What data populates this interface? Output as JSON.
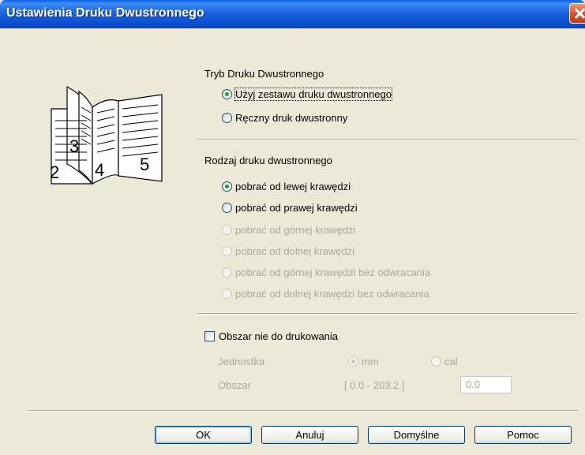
{
  "window": {
    "title": "Ustawienia Druku Dwustronnego"
  },
  "duplex_mode": {
    "label": "Tryb Druku Dwustronnego",
    "options": [
      {
        "label": "Użyj zestawu druku dwustronnego",
        "checked": true
      },
      {
        "label": "Ręczny druk dwustronny",
        "checked": false
      }
    ]
  },
  "illustration": {
    "page_numbers": [
      "2",
      "3",
      "4",
      "5"
    ]
  },
  "duplex_type": {
    "label": "Rodzaj druku dwustronnego",
    "options": [
      {
        "label": "pobrać od lewej krawędzi",
        "checked": true,
        "enabled": true
      },
      {
        "label": "pobrać od prawej krawędzi",
        "checked": false,
        "enabled": true
      },
      {
        "label": "pobrać od górnej krawędzi",
        "checked": false,
        "enabled": false
      },
      {
        "label": "pobrać od dolnej krawędzi",
        "checked": false,
        "enabled": false
      },
      {
        "label": "pobrać od górnej krawędzi bez odwracania",
        "checked": false,
        "enabled": false
      },
      {
        "label": "pobrać od dolnej krawędzi bez odwracania",
        "checked": false,
        "enabled": false
      }
    ]
  },
  "binding_offset": {
    "checkbox_label": "Obszar nie do drukowania",
    "checked": false,
    "unit_label": "Jednostka",
    "unit_options": [
      {
        "label": "mm",
        "checked": true
      },
      {
        "label": "cal",
        "checked": false
      }
    ],
    "area_label": "Obszar",
    "range": "[ 0.0 - 203.2 ]",
    "value": "0.0"
  },
  "buttons": {
    "ok": "OK",
    "cancel": "Anuluj",
    "defaults": "Domyślne",
    "help": "Pomoc"
  },
  "colors": {
    "titlebar": "#0a5fe4",
    "dialog_bg": "#ece9d8",
    "radio_check": "#21a121"
  }
}
